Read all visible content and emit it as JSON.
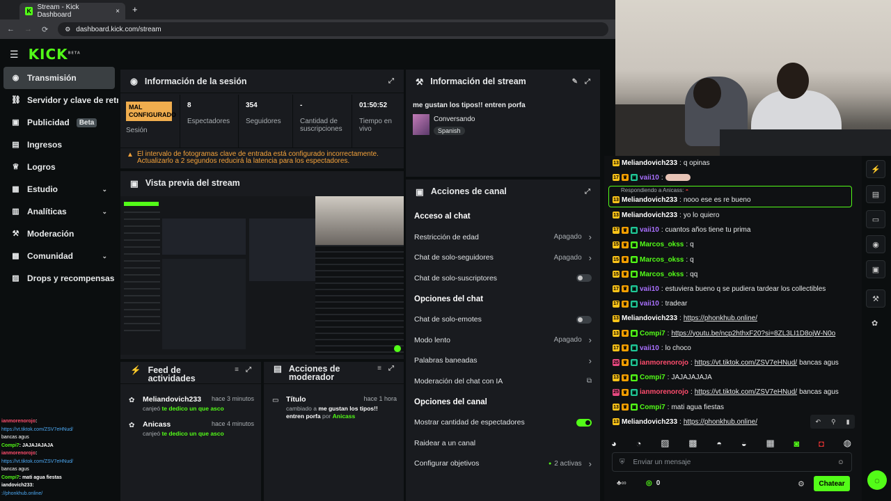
{
  "browser": {
    "tab_title": "Stream - Kick Dashboard",
    "new_tab": "+",
    "close": "×",
    "url": "dashboard.kick.com/stream"
  },
  "header": {
    "logo": "KICK",
    "logo_tag": "BETA"
  },
  "sidebar": {
    "items": [
      {
        "label": "Transmisión"
      },
      {
        "label": "Servidor y clave de retransmisión"
      },
      {
        "label": "Publicidad",
        "badge": "Beta"
      },
      {
        "label": "Ingresos"
      },
      {
        "label": "Logros"
      },
      {
        "label": "Estudio"
      },
      {
        "label": "Analíticas"
      },
      {
        "label": "Moderación"
      },
      {
        "label": "Comunidad"
      },
      {
        "label": "Drops y recompensas"
      }
    ]
  },
  "session": {
    "title": "Información de la sesión",
    "status_badge": "MAL CONFIGURADO",
    "status_label": "Sesión",
    "viewers": "8",
    "viewers_label": "Espectadores",
    "followers": "354",
    "followers_label": "Seguidores",
    "subs": "-",
    "subs_label": "Cantidad de suscripciones",
    "uptime": "01:50:52",
    "uptime_label": "Tiempo en vivo",
    "warning": "El intervalo de fotogramas clave de entrada está configurado incorrectamente. Actualizarlo a 2 segundos reducirá la latencia para los espectadores."
  },
  "stream_info": {
    "title": "Información del stream",
    "stream_title": "me gustan los tipos!! entren porfa",
    "category": "Conversando",
    "language": "Spanish"
  },
  "preview": {
    "title": "Vista previa del stream"
  },
  "channel_actions": {
    "title": "Acciones de canal",
    "sections": [
      {
        "heading": "Acceso al chat",
        "rows": [
          {
            "label": "Restricción de edad",
            "value": "Apagado",
            "kind": "chevron"
          },
          {
            "label": "Chat de solo-seguidores",
            "value": "Apagado",
            "kind": "chevron"
          },
          {
            "label": "Chat de solo-suscriptores",
            "value": "",
            "kind": "toggle-off"
          }
        ]
      },
      {
        "heading": "Opciones del chat",
        "rows": [
          {
            "label": "Chat de solo-emotes",
            "value": "",
            "kind": "toggle-off"
          },
          {
            "label": "Modo lento",
            "value": "Apagado",
            "kind": "chevron"
          },
          {
            "label": "Palabras baneadas",
            "value": "",
            "kind": "chevron"
          },
          {
            "label": "Moderación del chat con IA",
            "value": "",
            "kind": "external"
          }
        ]
      },
      {
        "heading": "Opciones del canal",
        "rows": [
          {
            "label": "Mostrar cantidad de espectadores",
            "value": "",
            "kind": "toggle-on"
          },
          {
            "label": "Raidear a un canal",
            "value": "",
            "kind": "none"
          },
          {
            "label": "Configurar objetivos",
            "value": "2 activas",
            "kind": "chevron"
          }
        ]
      }
    ]
  },
  "activity": {
    "title": "Feed de actividades",
    "items": [
      {
        "user": "Meliandovich233",
        "time": "hace 3 minutos",
        "action": "canjeó",
        "reward": "te dedico un que asco"
      },
      {
        "user": "Anicass",
        "time": "hace 4 minutos",
        "action": "canjeó",
        "reward": "te dedico un que asco"
      }
    ]
  },
  "mod_actions": {
    "title": "Acciones de moderador",
    "items": [
      {
        "field": "Título",
        "time": "hace 1 hora",
        "prefix": "cambiado a",
        "value": "me gustan los tipos!! entren porfa",
        "by": "por",
        "user": "Anicass"
      }
    ]
  },
  "chat": {
    "reply_to": "Respondiendo a Anicass:",
    "messages": [
      {
        "badge": "13",
        "user": "Meliandovich233",
        "text": "q opinas",
        "color": "#ffffff",
        "sub": false
      },
      {
        "badge": "17",
        "user": "vaii10",
        "text": "",
        "color": "#a970ff",
        "sub": true,
        "emote": true
      },
      {
        "badge": "13",
        "user": "Meliandovich233",
        "text": "nooo ese es re bueno",
        "color": "#ffffff",
        "sub": false,
        "reply": true
      },
      {
        "badge": "13",
        "user": "Meliandovich233",
        "text": "yo lo quiero",
        "color": "#ffffff",
        "sub": false
      },
      {
        "badge": "17",
        "user": "vaii10",
        "text": "cuantos años tiene tu prima",
        "color": "#a970ff",
        "sub": true
      },
      {
        "badge": "15",
        "user": "Marcos_okss",
        "text": "q",
        "color": "#53fc18",
        "sub": true
      },
      {
        "badge": "15",
        "user": "Marcos_okss",
        "text": "q",
        "color": "#53fc18",
        "sub": true
      },
      {
        "badge": "15",
        "user": "Marcos_okss",
        "text": "qq",
        "color": "#53fc18",
        "sub": true
      },
      {
        "badge": "17",
        "user": "vaii10",
        "text": "estuviera bueno q se pudiera tardear los collectibles",
        "color": "#a970ff",
        "sub": true
      },
      {
        "badge": "17",
        "user": "vaii10",
        "text": "tradear",
        "color": "#a970ff",
        "sub": true
      },
      {
        "badge": "13",
        "user": "Meliandovich233",
        "text": "",
        "link": "https://phonkhub.online/",
        "color": "#ffffff",
        "sub": false
      },
      {
        "badge": "13",
        "user": "Compi7",
        "text": "",
        "link": "https://youtu.be/ncp2hthxF20?si=8ZL3LI1D8ojW-N0o",
        "color": "#53fc18",
        "sub": true
      },
      {
        "badge": "17",
        "user": "vaii10",
        "text": "lo choco",
        "color": "#a970ff",
        "sub": true
      },
      {
        "badge": "25",
        "user": "ianmorenorojo",
        "text": " bancas agus",
        "link": "https://vt.tiktok.com/ZSV7eHNud/",
        "color": "#ff4d6d",
        "sub": true
      },
      {
        "badge": "13",
        "user": "Compi7",
        "text": "JAJAJAJAJA",
        "color": "#53fc18",
        "sub": true
      },
      {
        "badge": "25",
        "user": "ianmorenorojo",
        "text": " bancas agus",
        "link": "https://vt.tiktok.com/ZSV7eHNud/",
        "color": "#ff4d6d",
        "sub": true
      },
      {
        "badge": "13",
        "user": "Compi7",
        "text": "mati agua fiestas",
        "color": "#53fc18",
        "sub": true
      },
      {
        "badge": "13",
        "user": "Meliandovich233",
        "text": "",
        "link": "https://phonkhub.online/",
        "color": "#ffffff",
        "sub": false
      }
    ],
    "input_placeholder": "Enviar un mensaje",
    "points": "0",
    "send": "Chatear"
  },
  "mini_chat": {
    "lines": [
      {
        "user": "ianmorenorojo",
        "text": ":",
        "color": "#ff4d6d"
      },
      {
        "user": "",
        "text": "https://vt.tiktok.com/ZSV7eHNud/",
        "color": "#4dabf7"
      },
      {
        "user": "",
        "text": "bancas agus",
        "color": "#ffffff"
      },
      {
        "user": "Compi7",
        "text": ": JAJAJAJAJA",
        "color": "#53fc18"
      },
      {
        "user": "ianmorenorojo",
        "text": ":",
        "color": "#ff4d6d"
      },
      {
        "user": "",
        "text": "https://vt.tiktok.com/ZSV7eHNud/",
        "color": "#4dabf7"
      },
      {
        "user": "",
        "text": "bancas agus",
        "color": "#ffffff"
      },
      {
        "user": "Compi7",
        "text": ": mati agua fiestas",
        "color": "#53fc18"
      },
      {
        "user": "iandovich233",
        "text": ":",
        "color": "#ffffff"
      },
      {
        "user": "",
        "text": "://phonkhub.online/",
        "color": "#4dabf7"
      }
    ]
  },
  "colors": {
    "accent": "#53fc18",
    "warning": "#f0ad4e",
    "panel": "#191b1f",
    "bg": "#0b0e0f"
  }
}
